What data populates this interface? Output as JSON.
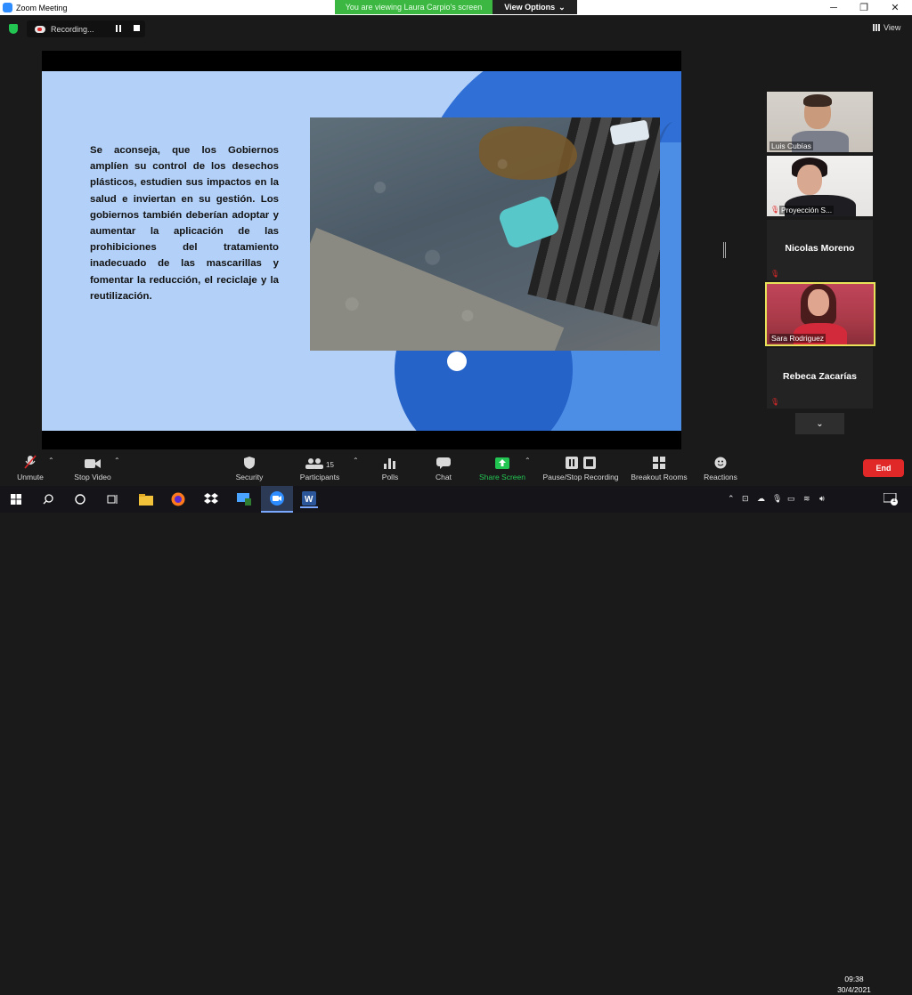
{
  "window": {
    "title": "Zoom Meeting"
  },
  "banner": {
    "viewing_text": "You are viewing Laura Carpio's screen",
    "view_options_label": "View Options"
  },
  "recording": {
    "status_text": "Recording..."
  },
  "view_button": {
    "label": "View"
  },
  "slide": {
    "body_text": "Se aconseja, que los Gobiernos amplíen su control de los desechos plásticos, estudien sus impactos en la salud e inviertan en su gestión. Los gobiernos también deberían adoptar y aumentar la aplicación de las prohibiciones del tratamiento inadecuado de las mascarillas y fomentar la reducción, el reciclaje y la reutilización."
  },
  "participants": [
    {
      "name": "Luis Cubías",
      "type": "video"
    },
    {
      "name": "Proyección S...",
      "type": "video",
      "muted": true
    },
    {
      "name": "Nicolas Moreno",
      "type": "name-only",
      "muted": true
    },
    {
      "name": "Sara Rodriguez",
      "type": "video",
      "active_speaker": true
    },
    {
      "name": "Rebeca Zacarías",
      "type": "name-only",
      "muted": true
    }
  ],
  "toolbar": {
    "unmute": "Unmute",
    "stop_video": "Stop Video",
    "security": "Security",
    "participants": "Participants",
    "participants_count": "15",
    "polls": "Polls",
    "chat": "Chat",
    "share_screen": "Share Screen",
    "pause_stop_recording": "Pause/Stop Recording",
    "breakout_rooms": "Breakout Rooms",
    "reactions": "Reactions",
    "end": "End"
  },
  "taskbar": {
    "time": "09:38",
    "date": "30/4/2021",
    "notification_count": "1"
  },
  "colors": {
    "accent_green": "#3cb742",
    "end_red": "#e02828",
    "share_green": "#23c552",
    "zoom_blue": "#2d8cff"
  }
}
